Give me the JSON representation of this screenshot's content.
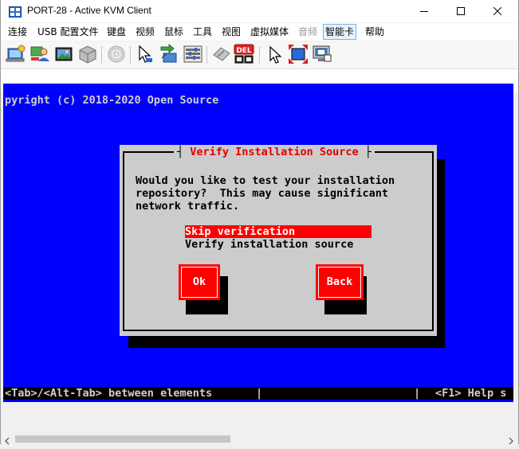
{
  "window": {
    "title": "PORT-28 - Active KVM Client"
  },
  "menubar": {
    "items": [
      {
        "label": "连接"
      },
      {
        "label": "USB 配置文件"
      },
      {
        "label": "键盘"
      },
      {
        "label": "视频"
      },
      {
        "label": "鼠标"
      },
      {
        "label": "工具"
      },
      {
        "label": "视图"
      },
      {
        "label": "虚拟媒体"
      },
      {
        "label": "音频"
      },
      {
        "label": "智能卡"
      },
      {
        "label": "帮助"
      }
    ]
  },
  "toolbar": {
    "del_badge": "DEL"
  },
  "console": {
    "top_line_partial": "-----  --  ---  -- --   -------- ----- ------- ------ --",
    "copyright": "pyright (c) 2018-2020 Open Source",
    "dialog": {
      "title": "Verify Installation Source",
      "message": [
        "Would you like to test your installation",
        "repository?  This may cause significant",
        "network traffic."
      ],
      "options": [
        {
          "label": "Skip verification",
          "selected": true
        },
        {
          "label": "Verify installation source",
          "selected": false
        }
      ],
      "ok_label": "Ok",
      "back_label": "Back"
    },
    "status": {
      "left": "<Tab>/<Alt-Tab> between elements",
      "sep1": "|",
      "sep2": "|",
      "right": "<F1> Help s"
    }
  },
  "colors": {
    "console_bg": "#0000ff",
    "dialog_bg": "#cccccc",
    "accent_red": "#ff0000",
    "title_red": "#e00000"
  }
}
